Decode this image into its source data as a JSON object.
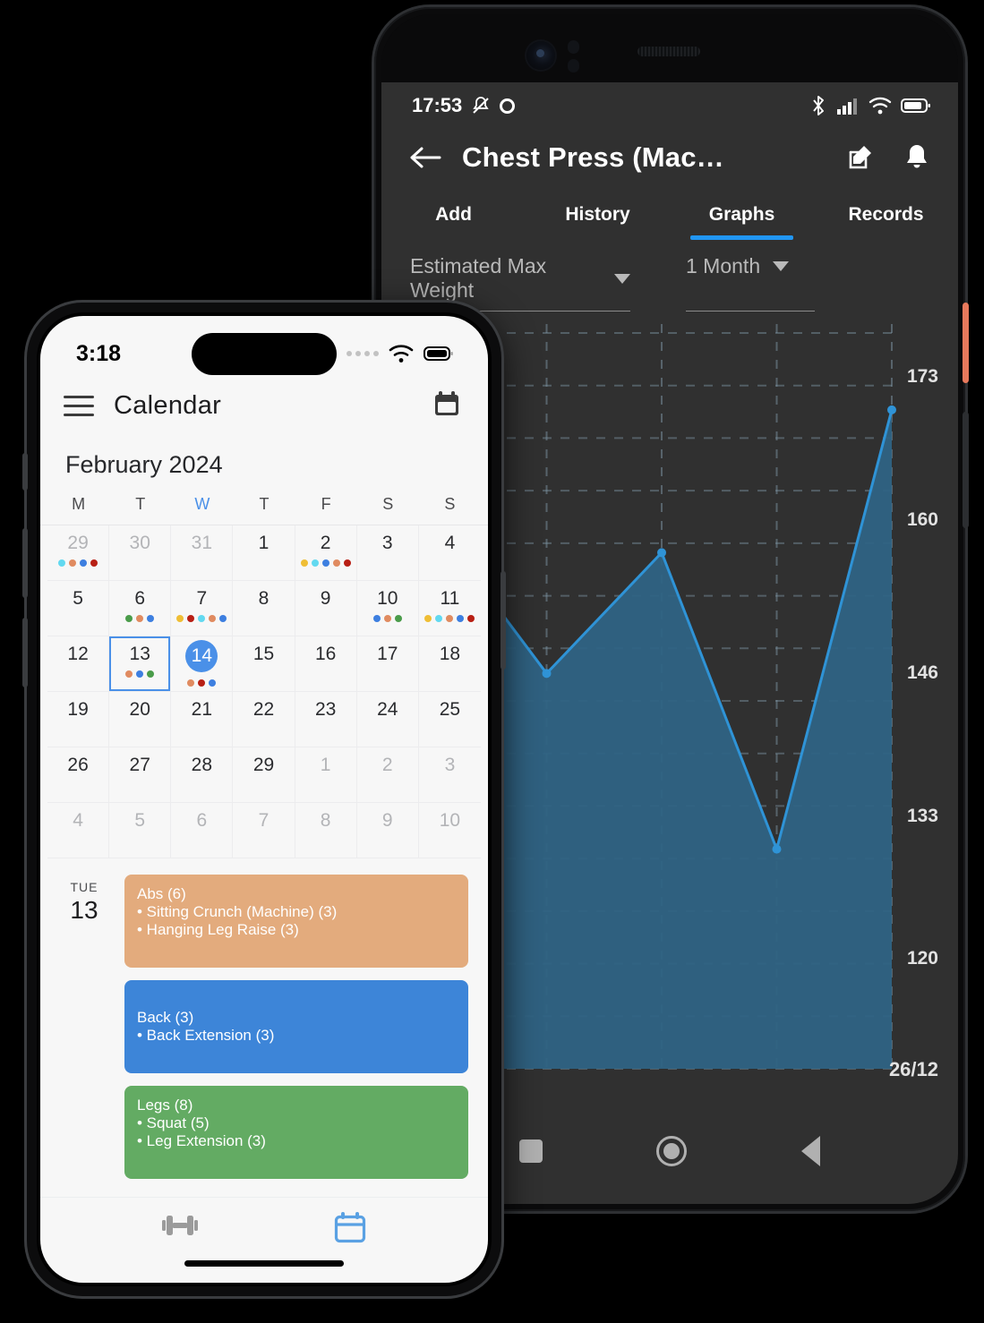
{
  "android": {
    "status": {
      "time": "17:53",
      "icons": [
        "mute-icon",
        "record-icon",
        "bluetooth-icon",
        "cellular-icon",
        "wifi-icon",
        "battery-icon"
      ]
    },
    "appbar": {
      "back": "←",
      "title": "Chest Press (Mac…",
      "edit_icon": "edit-icon",
      "bell_icon": "bell-icon"
    },
    "tabs": [
      {
        "label": "Add",
        "active": false
      },
      {
        "label": "History",
        "active": false
      },
      {
        "label": "Graphs",
        "active": true
      },
      {
        "label": "Records",
        "active": false
      }
    ],
    "filters": {
      "metric": "Estimated Max Weight",
      "range": "1 Month"
    },
    "navbar": {
      "recents": "square-icon",
      "home": "circle-icon",
      "back": "triangle-back-icon"
    },
    "accent": "#2196f3"
  },
  "chart_data": {
    "type": "area",
    "title": "Estimated Max Weight",
    "xlabel": "",
    "ylabel": "",
    "grid": true,
    "legend": false,
    "yticks": [
      120,
      133,
      146,
      160,
      173
    ],
    "ylim": [
      110,
      177
    ],
    "xticks": [
      "26/12"
    ],
    "x": [
      0,
      1,
      2,
      3,
      4
    ],
    "values": [
      160,
      146,
      157,
      130,
      170
    ],
    "series": [
      {
        "name": "Estimated Max Weight",
        "values": [
          160,
          146,
          157,
          130,
          170
        ]
      }
    ],
    "line_color": "#2f93d6",
    "fill_color": "#2f6384",
    "background": "#303030"
  },
  "iphone": {
    "status": {
      "time": "3:18",
      "icons": [
        "signal-dots-icon",
        "wifi-icon",
        "battery-icon"
      ]
    },
    "appbar": {
      "menu_icon": "hamburger-icon",
      "title": "Calendar",
      "calendar_icon": "calendar-icon"
    },
    "calendar": {
      "month": "February 2024",
      "dow": [
        {
          "label": "M",
          "today": false
        },
        {
          "label": "T",
          "today": false
        },
        {
          "label": "W",
          "today": true
        },
        {
          "label": "T",
          "today": false
        },
        {
          "label": "F",
          "today": false
        },
        {
          "label": "S",
          "today": false
        },
        {
          "label": "S",
          "today": false
        }
      ],
      "palette": {
        "cyan": "#62d9f0",
        "orange": "#e08b60",
        "blue": "#3d7fe0",
        "darkred": "#b81f14",
        "yellow": "#efbe35",
        "green": "#4a9c4a"
      },
      "days": [
        {
          "n": "29",
          "muted": true,
          "dots": [
            "cyan",
            "orange",
            "blue",
            "darkred"
          ]
        },
        {
          "n": "30",
          "muted": true,
          "dots": []
        },
        {
          "n": "31",
          "muted": true,
          "dots": []
        },
        {
          "n": "1",
          "muted": false,
          "dots": []
        },
        {
          "n": "2",
          "muted": false,
          "dots": [
            "yellow",
            "cyan",
            "blue",
            "orange",
            "darkred"
          ]
        },
        {
          "n": "3",
          "muted": false,
          "dots": []
        },
        {
          "n": "4",
          "muted": false,
          "dots": []
        },
        {
          "n": "5",
          "muted": false,
          "dots": []
        },
        {
          "n": "6",
          "muted": false,
          "dots": [
            "green",
            "orange",
            "blue"
          ]
        },
        {
          "n": "7",
          "muted": false,
          "dots": [
            "yellow",
            "darkred",
            "cyan",
            "orange",
            "blue"
          ]
        },
        {
          "n": "8",
          "muted": false,
          "dots": []
        },
        {
          "n": "9",
          "muted": false,
          "dots": []
        },
        {
          "n": "10",
          "muted": false,
          "dots": [
            "blue",
            "orange",
            "green"
          ]
        },
        {
          "n": "11",
          "muted": false,
          "dots": [
            "yellow",
            "cyan",
            "orange",
            "blue",
            "darkred"
          ]
        },
        {
          "n": "12",
          "muted": false,
          "dots": []
        },
        {
          "n": "13",
          "muted": false,
          "dots": [
            "orange",
            "blue",
            "green"
          ],
          "selected": true
        },
        {
          "n": "14",
          "muted": false,
          "dots": [
            "orange",
            "darkred",
            "blue"
          ],
          "today": true
        },
        {
          "n": "15",
          "muted": false,
          "dots": []
        },
        {
          "n": "16",
          "muted": false,
          "dots": []
        },
        {
          "n": "17",
          "muted": false,
          "dots": []
        },
        {
          "n": "18",
          "muted": false,
          "dots": []
        },
        {
          "n": "19",
          "muted": false,
          "dots": []
        },
        {
          "n": "20",
          "muted": false,
          "dots": []
        },
        {
          "n": "21",
          "muted": false,
          "dots": []
        },
        {
          "n": "22",
          "muted": false,
          "dots": []
        },
        {
          "n": "23",
          "muted": false,
          "dots": []
        },
        {
          "n": "24",
          "muted": false,
          "dots": []
        },
        {
          "n": "25",
          "muted": false,
          "dots": []
        },
        {
          "n": "26",
          "muted": false,
          "dots": []
        },
        {
          "n": "27",
          "muted": false,
          "dots": []
        },
        {
          "n": "28",
          "muted": false,
          "dots": []
        },
        {
          "n": "29",
          "muted": false,
          "dots": []
        },
        {
          "n": "1",
          "muted": true,
          "dots": []
        },
        {
          "n": "2",
          "muted": true,
          "dots": []
        },
        {
          "n": "3",
          "muted": true,
          "dots": []
        },
        {
          "n": "4",
          "muted": true,
          "dots": []
        },
        {
          "n": "5",
          "muted": true,
          "dots": []
        },
        {
          "n": "6",
          "muted": true,
          "dots": []
        },
        {
          "n": "7",
          "muted": true,
          "dots": []
        },
        {
          "n": "8",
          "muted": true,
          "dots": []
        },
        {
          "n": "9",
          "muted": true,
          "dots": []
        },
        {
          "n": "10",
          "muted": true,
          "dots": []
        }
      ]
    },
    "agenda": {
      "dow": "TUE",
      "day": "13",
      "events": [
        {
          "title": "Abs (6)",
          "color": "#e3ab7d",
          "items": [
            "• Sitting Crunch (Machine) (3)",
            "• Hanging Leg Raise (3)"
          ]
        },
        {
          "title": "Back (3)",
          "color": "#3d85d8",
          "items": [
            "• Back Extension (3)"
          ]
        },
        {
          "title": "Legs (8)",
          "color": "#63ab63",
          "items": [
            "• Squat (5)",
            "• Leg Extension (3)"
          ]
        }
      ]
    },
    "bottomnav": [
      {
        "icon": "dumbbell-icon",
        "active": false
      },
      {
        "icon": "calendar-icon",
        "active": true
      }
    ],
    "accent": "#4a90e8"
  }
}
